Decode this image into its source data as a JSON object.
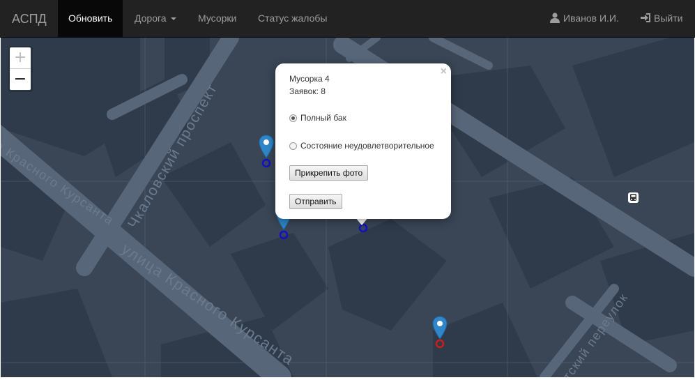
{
  "navbar": {
    "brand": "АСПД",
    "refresh": "Обновить",
    "road": "Дорога",
    "bins": "Мусорки",
    "complaint_status": "Статус жалобы",
    "user": "Иванов И.И.",
    "logout": "Выйти"
  },
  "map": {
    "zoom_in": "+",
    "zoom_out": "−",
    "streets": {
      "chkalovsky": "Чкаловский проспект",
      "krasnogo_main": "улица Красного Курсанта",
      "krasnogo_left": "а Красного Курсанта",
      "lane": "нтский переулок"
    }
  },
  "popup": {
    "close": "×",
    "title": "Мусорка 4",
    "requests": "Заявок: 8",
    "option_full": "Полный бак",
    "option_bad": "Состояние неудовлетворительное",
    "attach_photo": "Прикрепить фото",
    "submit": "Отправить"
  },
  "colors": {
    "navbar": "#222222",
    "map_bg": "#3a4656",
    "pin_blue": "#2f87c9",
    "ring_blue": "#1010c8",
    "ring_red": "#d11b1b"
  }
}
